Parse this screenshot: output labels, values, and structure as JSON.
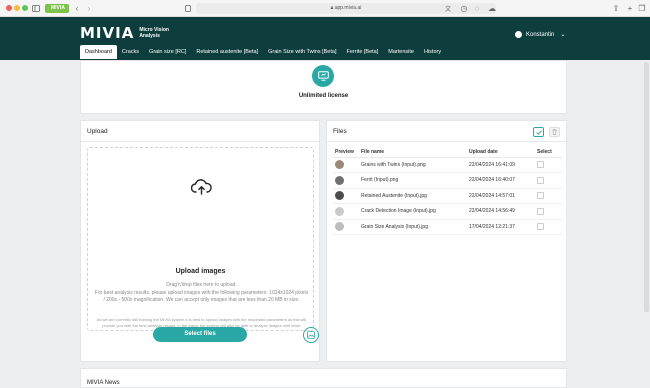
{
  "browser": {
    "tab_badge": "MIVIA",
    "url": "app.mivia.ai"
  },
  "header": {
    "logo_word": "MIVIA",
    "logo_sub": "Micro Vision Analysis",
    "user_name": "Konstantin",
    "tabs": [
      {
        "label": "Dashboard"
      },
      {
        "label": "Cracks"
      },
      {
        "label": "Grain size [RC]"
      },
      {
        "label": "Retained austenite [Beta]"
      },
      {
        "label": "Grain Size with Twins [Beta]"
      },
      {
        "label": "Ferrite [Beta]"
      },
      {
        "label": "Martensite"
      },
      {
        "label": "History"
      }
    ]
  },
  "license": {
    "text": "Unlimited license"
  },
  "upload": {
    "title": "Upload",
    "heading": "Upload images",
    "hint": "Drag'n'drop files here to upload.",
    "description": "For best analysis results, please upload images with the following parameters: 1024x1024 pixels / 200x - 500x magnification. We can accept only images that are less than 20 MB in size.",
    "note": "As we are currently still training the MIVIA system it is best to upload images with the requested parameters as this will provide you with the best analysis results. In the future the system will also be able to analyze images with lower resolutions and different magnifications.",
    "button": "Select files"
  },
  "files": {
    "title": "Files",
    "columns": [
      "Preview",
      "File name",
      "Upload date",
      "Select"
    ],
    "rows": [
      {
        "thumb_color": "#9c8878",
        "name": "Grains with Twins (Input).png",
        "date": "22/04/2024 16:41:09"
      },
      {
        "thumb_color": "#6f6f6f",
        "name": "Ferrit (Input).png",
        "date": "22/04/2024 16:40:07"
      },
      {
        "thumb_color": "#4d4d4d",
        "name": "Retained Austenite (Input).jpg",
        "date": "22/04/2024 14:57:01"
      },
      {
        "thumb_color": "#c9c9c9",
        "name": "Crack Detection Image (Input).jpg",
        "date": "22/04/2024 14:56:49"
      },
      {
        "thumb_color": "#bdbdbd",
        "name": "Grain Size Analysis (Input).jpg",
        "date": "17/04/2024 12:21:37"
      }
    ]
  },
  "news": {
    "title": "MIVIA News"
  },
  "colors": {
    "header": "#0e3d3e",
    "accent": "#2aa8a5"
  }
}
